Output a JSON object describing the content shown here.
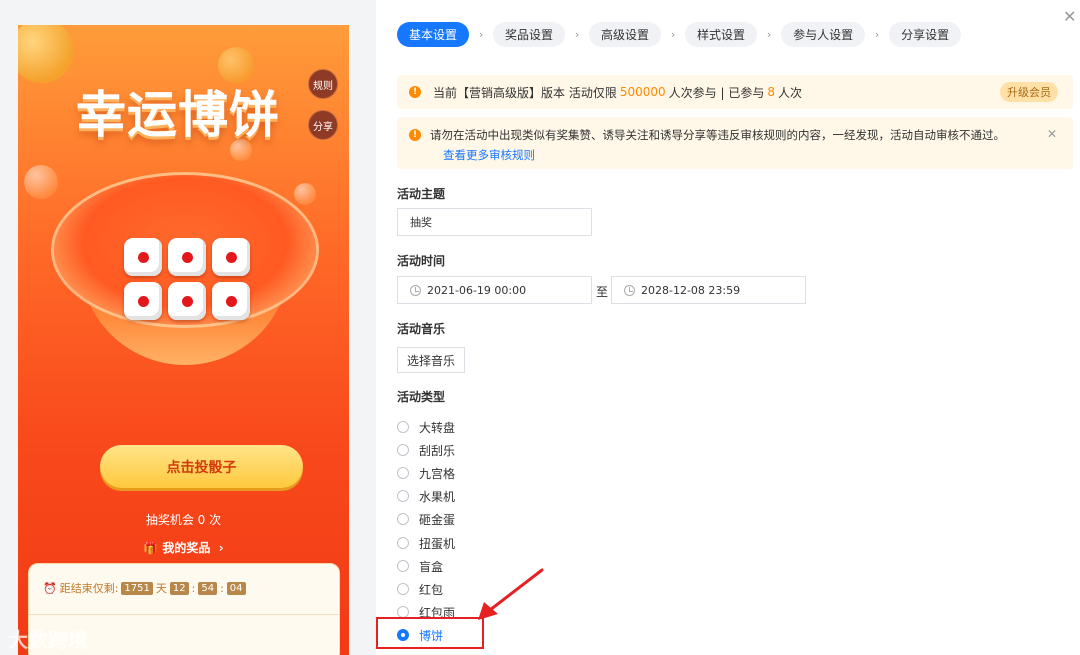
{
  "preview": {
    "title": "幸运博饼",
    "rules_label": "规则",
    "share_label": "分享",
    "roll_button": "点击投骰子",
    "chances": "抽奖机会 0 次",
    "my_prizes": "我的奖品",
    "countdown_prefix": "距结束仅剩:",
    "countdown_days": "1751",
    "countdown_day_unit": "天",
    "countdown_hours": "12",
    "countdown_minutes": "54",
    "countdown_seconds": "04",
    "watermark": "大数跨境"
  },
  "steps": [
    "基本设置",
    "奖品设置",
    "高级设置",
    "样式设置",
    "参与人设置",
    "分享设置"
  ],
  "notice": {
    "text_a": "当前【营销高级版】版本 活动仅限",
    "limit": "500000",
    "text_b": "人次参与 | 已参与",
    "joined": "8",
    "text_c": "人次",
    "upgrade": "升级会员",
    "review": "请勿在活动中出现类似有奖集赞、诱导关注和诱导分享等违反审核规则的内容，一经发现，活动自动审核不通过。",
    "review_link": "查看更多审核规则"
  },
  "form": {
    "theme_label": "活动主题",
    "theme_value": "抽奖",
    "time_label": "活动时间",
    "start_time": "2021-06-19 00:00",
    "to": "至",
    "end_time": "2028-12-08 23:59",
    "music_label": "活动音乐",
    "music_button": "选择音乐",
    "type_label": "活动类型",
    "types": [
      "大转盘",
      "刮刮乐",
      "九宫格",
      "水果机",
      "砸金蛋",
      "扭蛋机",
      "盲盒",
      "红包",
      "红包雨",
      "博饼"
    ],
    "selected_type": "博饼"
  },
  "colors": {
    "accent": "#1677ff",
    "warning": "#ff8a00",
    "highlight": "#e52121"
  }
}
